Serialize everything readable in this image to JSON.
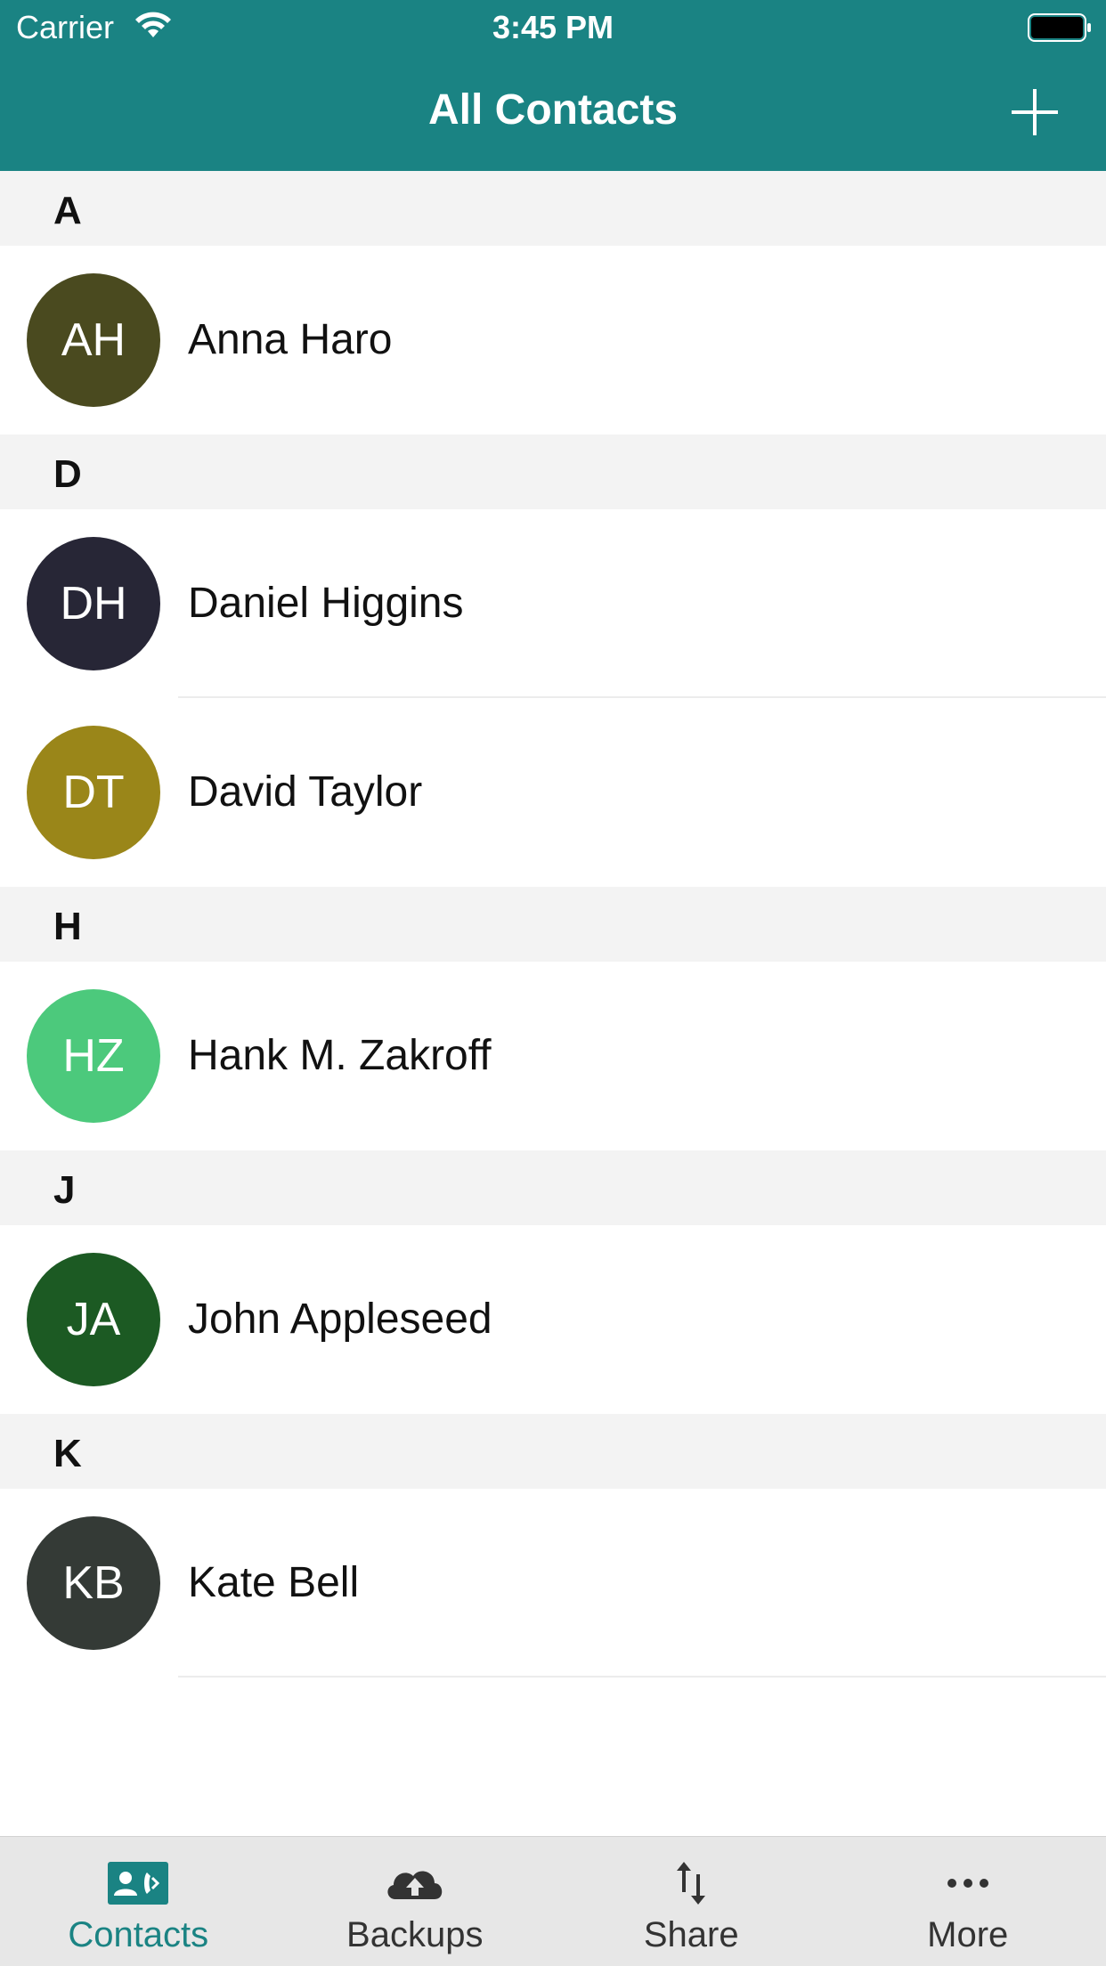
{
  "status_bar": {
    "carrier": "Carrier",
    "time": "3:45 PM"
  },
  "header": {
    "title": "All Contacts",
    "add_icon": "plus-icon"
  },
  "sections": [
    {
      "letter": "A",
      "contacts": [
        {
          "initials": "AH",
          "name": "Anna Haro",
          "color": "#4a4a1f"
        }
      ]
    },
    {
      "letter": "D",
      "contacts": [
        {
          "initials": "DH",
          "name": "Daniel Higgins",
          "color": "#272636"
        },
        {
          "initials": "DT",
          "name": "David Taylor",
          "color": "#9a8619"
        }
      ]
    },
    {
      "letter": "H",
      "contacts": [
        {
          "initials": "HZ",
          "name": "Hank M. Zakroff",
          "color": "#4cc97c"
        }
      ]
    },
    {
      "letter": "J",
      "contacts": [
        {
          "initials": "JA",
          "name": "John Appleseed",
          "color": "#1c5a23"
        }
      ]
    },
    {
      "letter": "K",
      "contacts": [
        {
          "initials": "KB",
          "name": "Kate Bell",
          "color": "#343a36"
        }
      ]
    }
  ],
  "tabs": [
    {
      "label": "Contacts",
      "icon": "contacts-icon",
      "active": true
    },
    {
      "label": "Backups",
      "icon": "cloud-upload-icon",
      "active": false
    },
    {
      "label": "Share",
      "icon": "share-arrows-icon",
      "active": false
    },
    {
      "label": "More",
      "icon": "more-icon",
      "active": false
    }
  ],
  "colors": {
    "accent": "#1a8383",
    "section_bg": "#f3f3f3",
    "tabbar_bg": "#e7e7e7"
  }
}
